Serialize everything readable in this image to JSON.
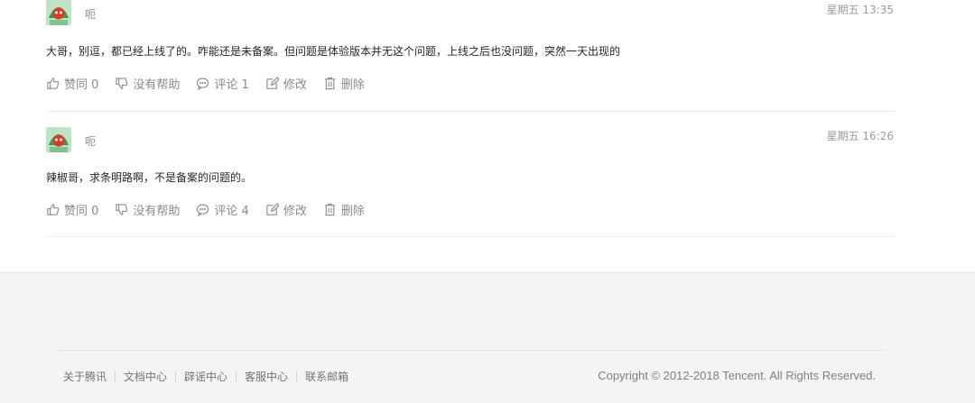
{
  "posts": [
    {
      "username": "呃",
      "time": "星期五 13:35",
      "text": "大哥，别逗，都已经上线了的。咋能还是未备案。但问题是体验版本并无这个问题，上线之后也没问题，突然一天出现的",
      "actions": {
        "like": "赞同 0",
        "unhelpful": "没有帮助",
        "comment": "评论 1",
        "edit": "修改",
        "delete": "删除"
      }
    },
    {
      "username": "呃",
      "time": "星期五 16:26",
      "text": "辣椒哥，求条明路啊，不是备案的问题的。",
      "actions": {
        "like": "赞同 0",
        "unhelpful": "没有帮助",
        "comment": "评论 4",
        "edit": "修改",
        "delete": "删除"
      }
    }
  ],
  "footer": {
    "links": [
      "关于腾讯",
      "文档中心",
      "辟谣中心",
      "客服中心",
      "联系邮箱"
    ],
    "copyright": "Copyright © 2012-2018 Tencent. All Rights Reserved."
  }
}
